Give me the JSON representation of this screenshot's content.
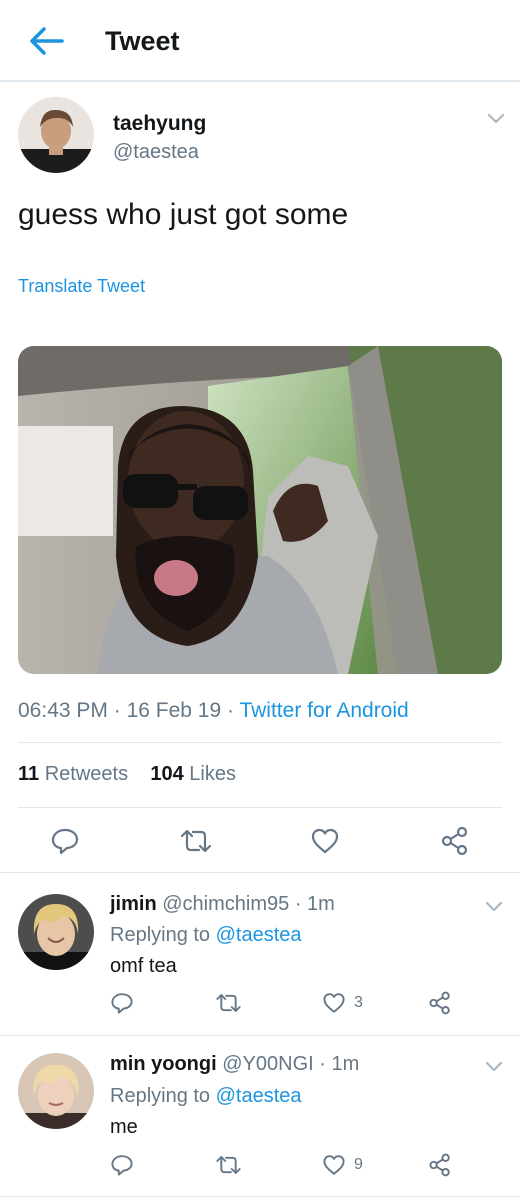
{
  "header": {
    "title": "Tweet"
  },
  "tweet": {
    "name": "taehyung",
    "handle": "@taestea",
    "text": "guess who just got some",
    "translate": "Translate Tweet",
    "time": "06:43 PM",
    "sep1": "·",
    "date": "16 Feb 19",
    "sep2": "·",
    "app": "Twitter for Android",
    "retweets_count": "11",
    "retweets_label": "Retweets",
    "likes_count": "104",
    "likes_label": "Likes"
  },
  "replies": [
    {
      "name": "jimin",
      "handle": "@chimchim95",
      "sep": "·",
      "time": "1m",
      "replying_prefix": "Replying to",
      "mention": "@taestea",
      "text": "omf tea",
      "likes": "3"
    },
    {
      "name": "min yoongi",
      "handle": "@Y00NGI",
      "sep": "·",
      "time": "1m",
      "replying_prefix": "Replying to",
      "mention": "@taestea",
      "text": "me",
      "likes": "9"
    }
  ],
  "colors": {
    "accent": "#1b95e0",
    "muted": "#657786",
    "text": "#14171a",
    "border": "#e1e8ed"
  },
  "icons": [
    "back-arrow-icon",
    "chevron-down-icon",
    "reply-icon",
    "retweet-icon",
    "like-icon",
    "share-icon"
  ]
}
